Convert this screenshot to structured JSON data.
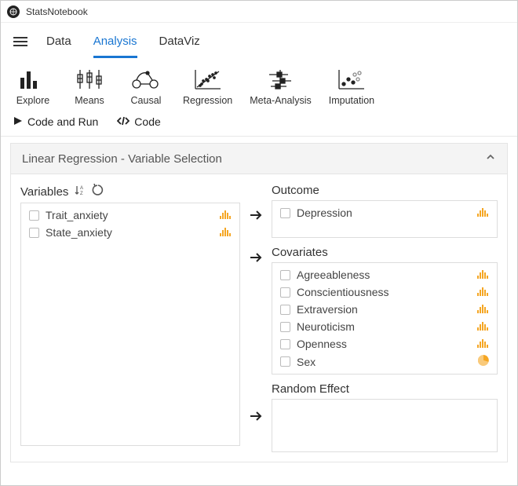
{
  "app": {
    "title": "StatsNotebook"
  },
  "nav": {
    "tabs": [
      {
        "label": "Data",
        "active": false
      },
      {
        "label": "Analysis",
        "active": true
      },
      {
        "label": "DataViz",
        "active": false
      }
    ]
  },
  "toolbar": [
    {
      "label": "Explore"
    },
    {
      "label": "Means"
    },
    {
      "label": "Causal"
    },
    {
      "label": "Regression"
    },
    {
      "label": "Meta-Analysis"
    },
    {
      "label": "Imputation"
    }
  ],
  "runbar": {
    "code_and_run": "Code and Run",
    "code": "Code"
  },
  "panel": {
    "title": "Linear Regression - Variable Selection",
    "variables_title": "Variables",
    "outcome_title": "Outcome",
    "covariates_title": "Covariates",
    "random_title": "Random Effect",
    "variables": [
      {
        "label": "Trait_anxiety",
        "icon": "dist"
      },
      {
        "label": "State_anxiety",
        "icon": "dist"
      }
    ],
    "outcome": [
      {
        "label": "Depression",
        "icon": "dist"
      }
    ],
    "covariates": [
      {
        "label": "Agreeableness",
        "icon": "dist"
      },
      {
        "label": "Conscientiousness",
        "icon": "dist"
      },
      {
        "label": "Extraversion",
        "icon": "dist"
      },
      {
        "label": "Neuroticism",
        "icon": "dist"
      },
      {
        "label": "Openness",
        "icon": "dist"
      },
      {
        "label": "Sex",
        "icon": "pie"
      }
    ],
    "random": []
  }
}
